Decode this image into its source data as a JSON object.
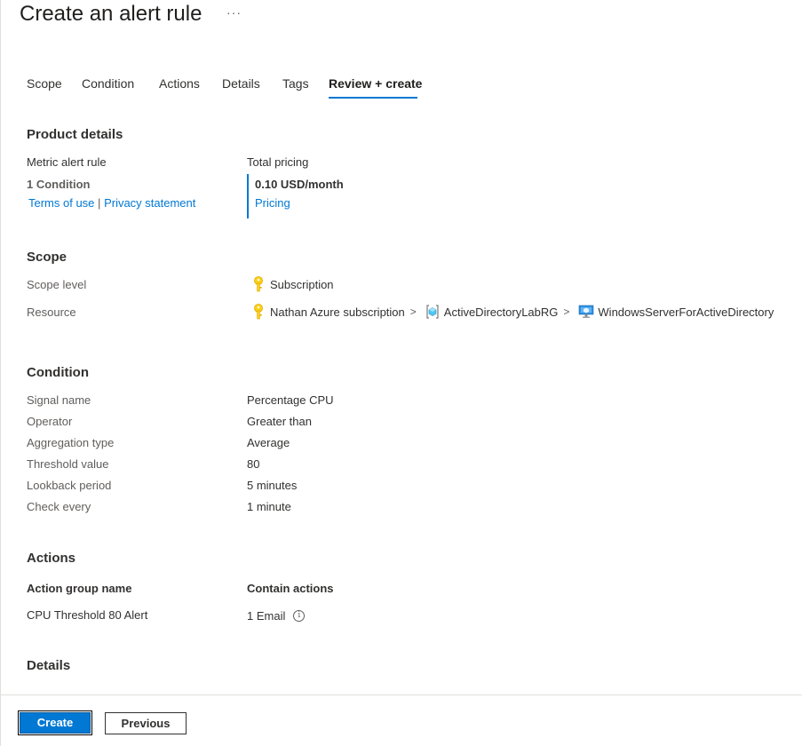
{
  "page": {
    "title": "Create an alert rule",
    "more_label": "···"
  },
  "tabs": [
    {
      "label": "Scope"
    },
    {
      "label": "Condition"
    },
    {
      "label": "Actions"
    },
    {
      "label": "Details"
    },
    {
      "label": "Tags"
    },
    {
      "label": "Review + create",
      "active": true
    }
  ],
  "product_details": {
    "heading": "Product details",
    "rule_type": "Metric alert rule",
    "condition_count": "1 Condition",
    "terms_link": "Terms of use",
    "separator": "|",
    "privacy_link": "Privacy statement",
    "total_pricing_label": "Total pricing",
    "price": "0.10 USD/month",
    "pricing_link": "Pricing"
  },
  "scope": {
    "heading": "Scope",
    "level_label": "Scope level",
    "level_value": "Subscription",
    "resource_label": "Resource",
    "resource_path": [
      {
        "name": "Nathan Azure subscription",
        "icon": "key-icon"
      },
      {
        "name": "ActiveDirectoryLabRG",
        "icon": "resource-group-icon"
      },
      {
        "name": "WindowsServerForActiveDirectory",
        "icon": "virtual-machine-icon"
      }
    ],
    "chevron": ">"
  },
  "condition": {
    "heading": "Condition",
    "rows": [
      {
        "label": "Signal name",
        "value": "Percentage CPU"
      },
      {
        "label": "Operator",
        "value": "Greater than"
      },
      {
        "label": "Aggregation type",
        "value": "Average"
      },
      {
        "label": "Threshold value",
        "value": "80"
      },
      {
        "label": "Lookback period",
        "value": "5 minutes"
      },
      {
        "label": "Check every",
        "value": "1 minute"
      }
    ]
  },
  "actions": {
    "heading": "Actions",
    "col_group": "Action group name",
    "col_contain": "Contain actions",
    "group_name": "CPU Threshold 80 Alert",
    "contain_value": "1 Email",
    "info_glyph": "i"
  },
  "details": {
    "heading": "Details"
  },
  "footer": {
    "create_label": "Create",
    "previous_label": "Previous"
  },
  "colors": {
    "accent": "#0078d4",
    "key_icon": "#fcd116",
    "text": "#323130",
    "muted": "#605e5c"
  }
}
